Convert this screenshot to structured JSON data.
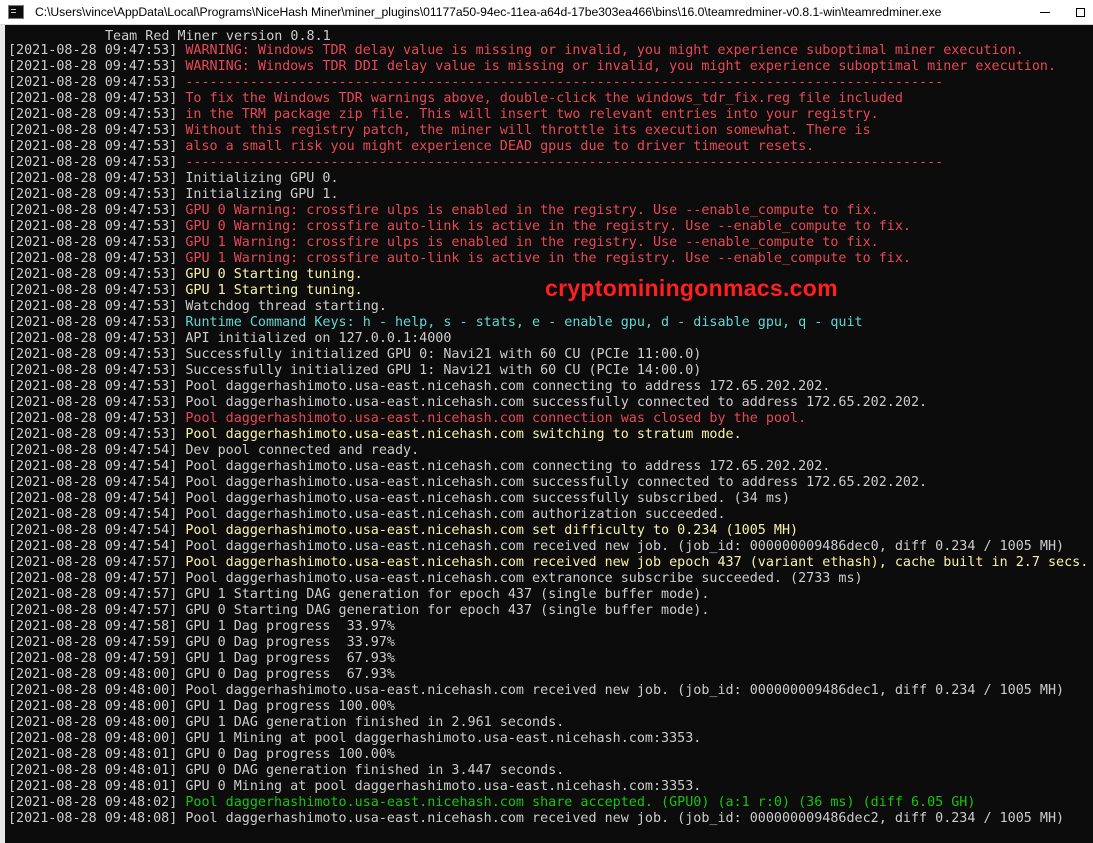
{
  "window": {
    "title": "C:\\Users\\vince\\AppData\\Local\\Programs\\NiceHash Miner\\miner_plugins\\01177a50-94ec-11ea-a64d-17be303ea466\\bins\\16.0\\teamredminer-v0.8.1-win\\teamredminer.exe",
    "minimize_icon": "minimize-icon",
    "maximize_icon": "maximize-icon"
  },
  "console": {
    "header": "Team Red Miner version 0.8.1",
    "colors": {
      "gray": "#cccccc",
      "red": "#e74856",
      "yellow": "#f9f1a5",
      "cyan": "#61d6d6",
      "green": "#16c60c"
    },
    "lines": [
      {
        "ts": "[2021-08-28 09:47:53]",
        "text": "WARNING: Windows TDR delay value is missing or invalid, you might experience suboptimal miner execution.",
        "color": "red"
      },
      {
        "ts": "[2021-08-28 09:47:53]",
        "text": "WARNING: Windows TDR DDI delay value is missing or invalid, you might experience suboptimal miner execution.",
        "color": "red"
      },
      {
        "ts": "[2021-08-28 09:47:53]",
        "text": "----------------------------------------------------------------------------------------------",
        "color": "red"
      },
      {
        "ts": "[2021-08-28 09:47:53]",
        "text": "To fix the Windows TDR warnings above, double-click the windows_tdr_fix.reg file included",
        "color": "red"
      },
      {
        "ts": "[2021-08-28 09:47:53]",
        "text": "in the TRM package zip file. This will insert two relevant entries into your registry.",
        "color": "red"
      },
      {
        "ts": "[2021-08-28 09:47:53]",
        "text": "Without this registry patch, the miner will throttle its execution somewhat. There is",
        "color": "red"
      },
      {
        "ts": "[2021-08-28 09:47:53]",
        "text": "also a small risk you might experience DEAD gpus due to driver timeout resets.",
        "color": "red"
      },
      {
        "ts": "[2021-08-28 09:47:53]",
        "text": "----------------------------------------------------------------------------------------------",
        "color": "red"
      },
      {
        "ts": "[2021-08-28 09:47:53]",
        "text": "Initializing GPU 0.",
        "color": "gray"
      },
      {
        "ts": "[2021-08-28 09:47:53]",
        "text": "Initializing GPU 1.",
        "color": "gray"
      },
      {
        "ts": "[2021-08-28 09:47:53]",
        "text": "GPU 0 Warning: crossfire ulps is enabled in the registry. Use --enable_compute to fix.",
        "color": "red"
      },
      {
        "ts": "[2021-08-28 09:47:53]",
        "text": "GPU 0 Warning: crossfire auto-link is active in the registry. Use --enable_compute to fix.",
        "color": "red"
      },
      {
        "ts": "[2021-08-28 09:47:53]",
        "text": "GPU 1 Warning: crossfire ulps is enabled in the registry. Use --enable_compute to fix.",
        "color": "red"
      },
      {
        "ts": "[2021-08-28 09:47:53]",
        "text": "GPU 1 Warning: crossfire auto-link is active in the registry. Use --enable_compute to fix.",
        "color": "red"
      },
      {
        "ts": "[2021-08-28 09:47:53]",
        "text": "GPU 0 Starting tuning.",
        "color": "yellow"
      },
      {
        "ts": "[2021-08-28 09:47:53]",
        "text": "GPU 1 Starting tuning.",
        "color": "yellow"
      },
      {
        "ts": "[2021-08-28 09:47:53]",
        "text": "Watchdog thread starting.",
        "color": "gray"
      },
      {
        "ts": "[2021-08-28 09:47:53]",
        "text": "Runtime Command Keys: h - help, s - stats, e - enable gpu, d - disable gpu, q - quit",
        "color": "cyan"
      },
      {
        "ts": "[2021-08-28 09:47:53]",
        "text": "API initialized on 127.0.0.1:4000",
        "color": "gray"
      },
      {
        "ts": "[2021-08-28 09:47:53]",
        "text": "Successfully initialized GPU 0: Navi21 with 60 CU (PCIe 11:00.0)",
        "color": "gray"
      },
      {
        "ts": "[2021-08-28 09:47:53]",
        "text": "Successfully initialized GPU 1: Navi21 with 60 CU (PCIe 14:00.0)",
        "color": "gray"
      },
      {
        "ts": "[2021-08-28 09:47:53]",
        "text": "Pool daggerhashimoto.usa-east.nicehash.com connecting to address 172.65.202.202.",
        "color": "gray"
      },
      {
        "ts": "[2021-08-28 09:47:53]",
        "text": "Pool daggerhashimoto.usa-east.nicehash.com successfully connected to address 172.65.202.202.",
        "color": "gray"
      },
      {
        "ts": "[2021-08-28 09:47:53]",
        "text": "Pool daggerhashimoto.usa-east.nicehash.com connection was closed by the pool.",
        "color": "red"
      },
      {
        "ts": "[2021-08-28 09:47:53]",
        "text": "Pool daggerhashimoto.usa-east.nicehash.com switching to stratum mode.",
        "color": "yellow"
      },
      {
        "ts": "[2021-08-28 09:47:54]",
        "text": "Dev pool connected and ready.",
        "color": "gray"
      },
      {
        "ts": "[2021-08-28 09:47:54]",
        "text": "Pool daggerhashimoto.usa-east.nicehash.com connecting to address 172.65.202.202.",
        "color": "gray"
      },
      {
        "ts": "[2021-08-28 09:47:54]",
        "text": "Pool daggerhashimoto.usa-east.nicehash.com successfully connected to address 172.65.202.202.",
        "color": "gray"
      },
      {
        "ts": "[2021-08-28 09:47:54]",
        "text": "Pool daggerhashimoto.usa-east.nicehash.com successfully subscribed. (34 ms)",
        "color": "gray"
      },
      {
        "ts": "[2021-08-28 09:47:54]",
        "text": "Pool daggerhashimoto.usa-east.nicehash.com authorization succeeded.",
        "color": "gray"
      },
      {
        "ts": "[2021-08-28 09:47:54]",
        "text": "Pool daggerhashimoto.usa-east.nicehash.com set difficulty to 0.234 (1005 MH)",
        "color": "yellow"
      },
      {
        "ts": "[2021-08-28 09:47:54]",
        "text": "Pool daggerhashimoto.usa-east.nicehash.com received new job. (job_id: 000000009486dec0, diff 0.234 / 1005 MH)",
        "color": "gray"
      },
      {
        "ts": "[2021-08-28 09:47:57]",
        "text": "Pool daggerhashimoto.usa-east.nicehash.com received new job epoch 437 (variant ethash), cache built in 2.7 secs.",
        "color": "yellow"
      },
      {
        "ts": "[2021-08-28 09:47:57]",
        "text": "Pool daggerhashimoto.usa-east.nicehash.com extranonce subscribe succeeded. (2733 ms)",
        "color": "gray"
      },
      {
        "ts": "[2021-08-28 09:47:57]",
        "text": "GPU 1 Starting DAG generation for epoch 437 (single buffer mode).",
        "color": "gray"
      },
      {
        "ts": "[2021-08-28 09:47:57]",
        "text": "GPU 0 Starting DAG generation for epoch 437 (single buffer mode).",
        "color": "gray"
      },
      {
        "ts": "[2021-08-28 09:47:58]",
        "text": "GPU 1 Dag progress  33.97%",
        "color": "gray"
      },
      {
        "ts": "[2021-08-28 09:47:59]",
        "text": "GPU 0 Dag progress  33.97%",
        "color": "gray"
      },
      {
        "ts": "[2021-08-28 09:47:59]",
        "text": "GPU 1 Dag progress  67.93%",
        "color": "gray"
      },
      {
        "ts": "[2021-08-28 09:48:00]",
        "text": "GPU 0 Dag progress  67.93%",
        "color": "gray"
      },
      {
        "ts": "[2021-08-28 09:48:00]",
        "text": "Pool daggerhashimoto.usa-east.nicehash.com received new job. (job_id: 000000009486dec1, diff 0.234 / 1005 MH)",
        "color": "gray"
      },
      {
        "ts": "[2021-08-28 09:48:00]",
        "text": "GPU 1 Dag progress 100.00%",
        "color": "gray"
      },
      {
        "ts": "[2021-08-28 09:48:00]",
        "text": "GPU 1 DAG generation finished in 2.961 seconds.",
        "color": "gray"
      },
      {
        "ts": "[2021-08-28 09:48:00]",
        "text": "GPU 1 Mining at pool daggerhashimoto.usa-east.nicehash.com:3353.",
        "color": "gray"
      },
      {
        "ts": "[2021-08-28 09:48:01]",
        "text": "GPU 0 Dag progress 100.00%",
        "color": "gray"
      },
      {
        "ts": "[2021-08-28 09:48:01]",
        "text": "GPU 0 DAG generation finished in 3.447 seconds.",
        "color": "gray"
      },
      {
        "ts": "[2021-08-28 09:48:01]",
        "text": "GPU 0 Mining at pool daggerhashimoto.usa-east.nicehash.com:3353.",
        "color": "gray"
      },
      {
        "ts": "[2021-08-28 09:48:02]",
        "text": "Pool daggerhashimoto.usa-east.nicehash.com share accepted. (GPU0) (a:1 r:0) (36 ms) (diff 6.05 GH)",
        "color": "green"
      },
      {
        "ts": "[2021-08-28 09:48:08]",
        "text": "Pool daggerhashimoto.usa-east.nicehash.com received new job. (job_id: 000000009486dec2, diff 0.234 / 1005 MH)",
        "color": "gray"
      }
    ]
  },
  "watermark": {
    "text": "cryptominingonmacs.com",
    "color": "#ff1f1f"
  }
}
